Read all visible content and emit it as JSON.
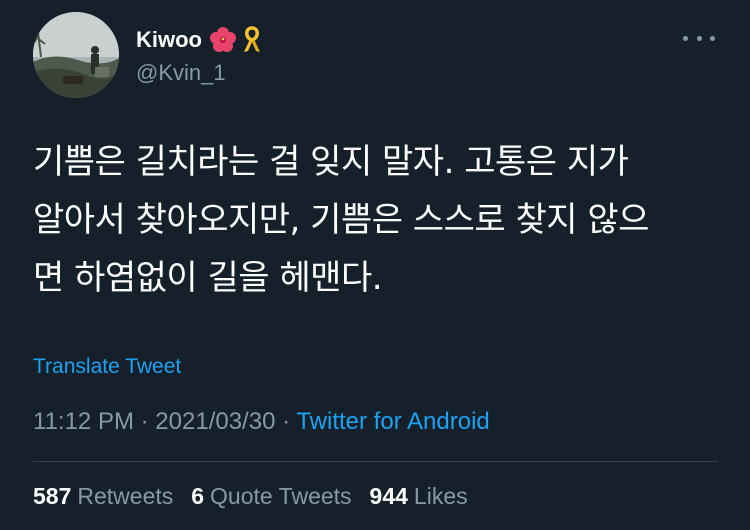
{
  "author": {
    "name": "Kiwoo",
    "handle": "@Kvin_1",
    "name_icons": [
      "hibiscus-icon",
      "yellow-ribbon-icon"
    ]
  },
  "tweet": {
    "lines": [
      "기쁨은 길치라는 걸 잊지 말자. 고통은 지가",
      "알아서 찾아오지만, 기쁨은 스스로 찾지 않으",
      "면 하염없이 길을 헤맨다."
    ],
    "translate_label": "Translate Tweet"
  },
  "meta": {
    "time": "11:12 PM",
    "separator": "·",
    "date": "2021/03/30",
    "source": "Twitter for Android"
  },
  "stats": {
    "retweets_count": "587",
    "retweets_label": "Retweets",
    "quote_count": "6",
    "quote_label": "Quote Tweets",
    "likes_count": "944",
    "likes_label": "Likes"
  },
  "colors": {
    "background": "#15202b",
    "accent": "#1da1f2",
    "secondary_text": "#8899a6",
    "divider": "#38444d"
  }
}
